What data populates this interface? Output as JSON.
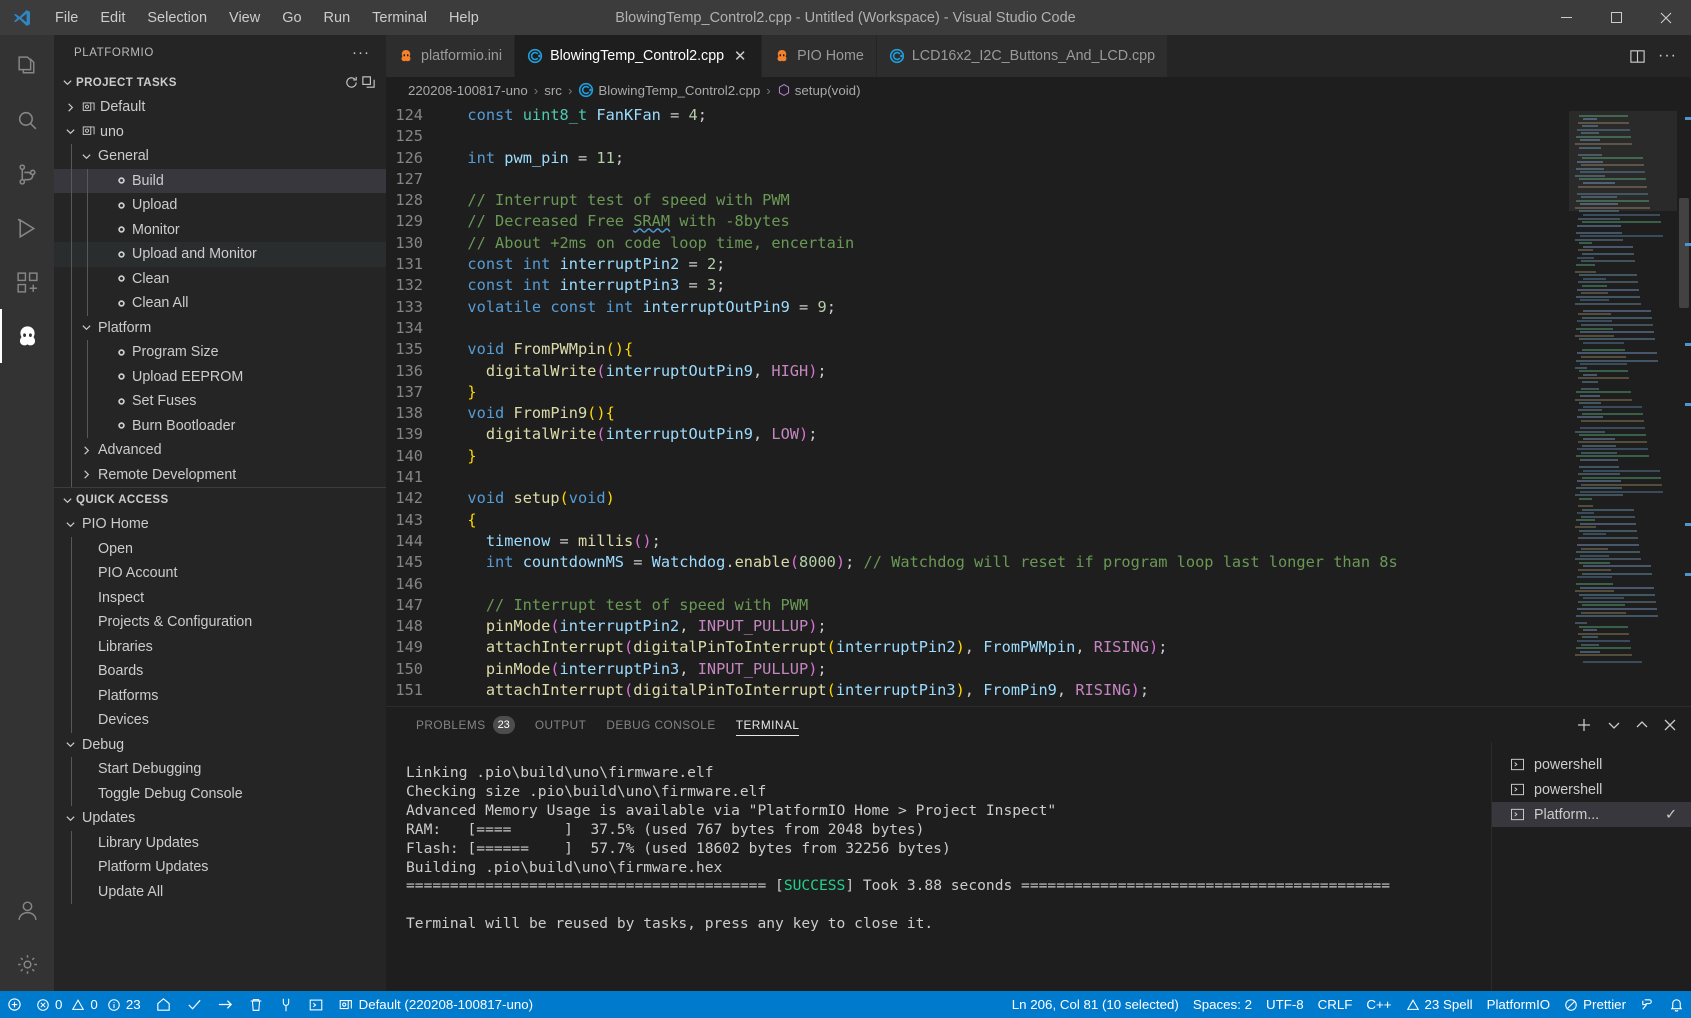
{
  "window": {
    "title": "BlowingTemp_Control2.cpp - Untitled (Workspace) - Visual Studio Code",
    "menus": [
      "File",
      "Edit",
      "Selection",
      "View",
      "Go",
      "Run",
      "Terminal",
      "Help"
    ],
    "controls": {
      "minimize": "minimize-icon",
      "maximize": "maximize-icon",
      "close": "close-icon"
    }
  },
  "activitybar": {
    "items": [
      {
        "name": "explorer",
        "icon": "files-icon"
      },
      {
        "name": "search",
        "icon": "search-icon"
      },
      {
        "name": "source-control",
        "icon": "source-control-icon"
      },
      {
        "name": "run-and-debug",
        "icon": "debug-alt-icon"
      },
      {
        "name": "extensions",
        "icon": "extensions-icon"
      },
      {
        "name": "platformio",
        "icon": "platformio-alien-icon"
      }
    ],
    "bottom": [
      {
        "name": "accounts",
        "icon": "account-icon"
      },
      {
        "name": "manage",
        "icon": "gear-icon"
      }
    ]
  },
  "sidebar": {
    "title": "PLATFORMIO",
    "more_actions": "···",
    "sections": [
      {
        "label": "PROJECT TASKS",
        "expanded": true,
        "actions": [
          "refresh-icon",
          "collapse-all-icon"
        ],
        "items": [
          {
            "label": "Default",
            "depth": 1,
            "twisty": "collapsed",
            "icon": "circuit-board-icon"
          },
          {
            "label": "uno",
            "depth": 1,
            "twisty": "expanded",
            "icon": "circuit-board-icon"
          },
          {
            "label": "General",
            "depth": 2,
            "twisty": "expanded",
            "icon": ""
          },
          {
            "label": "Build",
            "depth": 3,
            "twisty": "none",
            "icon": "task-dot-icon",
            "state": "selected"
          },
          {
            "label": "Upload",
            "depth": 3,
            "twisty": "none",
            "icon": "task-dot-icon"
          },
          {
            "label": "Monitor",
            "depth": 3,
            "twisty": "none",
            "icon": "task-dot-icon"
          },
          {
            "label": "Upload and Monitor",
            "depth": 3,
            "twisty": "none",
            "icon": "task-dot-icon",
            "state": "hovered"
          },
          {
            "label": "Clean",
            "depth": 3,
            "twisty": "none",
            "icon": "task-dot-icon"
          },
          {
            "label": "Clean All",
            "depth": 3,
            "twisty": "none",
            "icon": "task-dot-icon"
          },
          {
            "label": "Platform",
            "depth": 2,
            "twisty": "expanded",
            "icon": ""
          },
          {
            "label": "Program Size",
            "depth": 3,
            "twisty": "none",
            "icon": "task-dot-icon"
          },
          {
            "label": "Upload EEPROM",
            "depth": 3,
            "twisty": "none",
            "icon": "task-dot-icon"
          },
          {
            "label": "Set Fuses",
            "depth": 3,
            "twisty": "none",
            "icon": "task-dot-icon"
          },
          {
            "label": "Burn Bootloader",
            "depth": 3,
            "twisty": "none",
            "icon": "task-dot-icon"
          },
          {
            "label": "Advanced",
            "depth": 2,
            "twisty": "collapsed",
            "icon": ""
          },
          {
            "label": "Remote Development",
            "depth": 2,
            "twisty": "collapsed",
            "icon": ""
          }
        ]
      },
      {
        "label": "QUICK ACCESS",
        "expanded": true,
        "actions": [],
        "items": [
          {
            "label": "PIO Home",
            "depth": 1,
            "twisty": "expanded",
            "icon": ""
          },
          {
            "label": "Open",
            "depth": 2,
            "twisty": "none",
            "icon": ""
          },
          {
            "label": "PIO Account",
            "depth": 2,
            "twisty": "none",
            "icon": ""
          },
          {
            "label": "Inspect",
            "depth": 2,
            "twisty": "none",
            "icon": ""
          },
          {
            "label": "Projects & Configuration",
            "depth": 2,
            "twisty": "none",
            "icon": ""
          },
          {
            "label": "Libraries",
            "depth": 2,
            "twisty": "none",
            "icon": ""
          },
          {
            "label": "Boards",
            "depth": 2,
            "twisty": "none",
            "icon": ""
          },
          {
            "label": "Platforms",
            "depth": 2,
            "twisty": "none",
            "icon": ""
          },
          {
            "label": "Devices",
            "depth": 2,
            "twisty": "none",
            "icon": ""
          },
          {
            "label": "Debug",
            "depth": 1,
            "twisty": "expanded",
            "icon": ""
          },
          {
            "label": "Start Debugging",
            "depth": 2,
            "twisty": "none",
            "icon": ""
          },
          {
            "label": "Toggle Debug Console",
            "depth": 2,
            "twisty": "none",
            "icon": ""
          },
          {
            "label": "Updates",
            "depth": 1,
            "twisty": "expanded",
            "icon": ""
          },
          {
            "label": "Library Updates",
            "depth": 2,
            "twisty": "none",
            "icon": ""
          },
          {
            "label": "Platform Updates",
            "depth": 2,
            "twisty": "none",
            "icon": ""
          },
          {
            "label": "Update All",
            "depth": 2,
            "twisty": "none",
            "icon": ""
          }
        ]
      }
    ]
  },
  "editor": {
    "tabs": [
      {
        "label": "platformio.ini",
        "icon": "platformio-alien-icon",
        "active": false,
        "closable": false
      },
      {
        "label": "BlowingTemp_Control2.cpp",
        "icon": "cpp-icon",
        "active": true,
        "closable": true
      },
      {
        "label": "PIO Home",
        "icon": "platformio-alien-icon",
        "active": false,
        "closable": false
      },
      {
        "label": "LCD16x2_I2C_Buttons_And_LCD.cpp",
        "icon": "cpp-icon",
        "active": false,
        "closable": false
      }
    ],
    "tab_actions": [
      "split-editor-icon",
      "more-actions-icon"
    ],
    "breadcrumb": [
      {
        "label": "220208-100817-uno",
        "icon": ""
      },
      {
        "label": "src",
        "icon": ""
      },
      {
        "label": "BlowingTemp_Control2.cpp",
        "icon": "cpp-icon"
      },
      {
        "label": "setup(void)",
        "icon": "symbol-method-icon"
      }
    ],
    "first_line_number": 124,
    "lines": [
      {
        "n": 124,
        "html": "  <span class=\"kw\">const</span> <span class=\"typ\">uint8_t</span> <span class=\"var\">FanKFan</span> = <span class=\"num\">4</span>;"
      },
      {
        "n": 125,
        "html": ""
      },
      {
        "n": 126,
        "html": "  <span class=\"kw\">int</span> <span class=\"var\">pwm_pin</span> = <span class=\"num\">11</span>;"
      },
      {
        "n": 127,
        "html": ""
      },
      {
        "n": 128,
        "html": "  <span class=\"cmt\">// Interrupt test of speed with PWM</span>"
      },
      {
        "n": 129,
        "html": "  <span class=\"cmt\">// Decreased Free <span class=\"squig\">SRAM</span> with -8bytes</span>"
      },
      {
        "n": 130,
        "html": "  <span class=\"cmt\">// About +2ms on code loop time, encertain</span>"
      },
      {
        "n": 131,
        "html": "  <span class=\"kw\">const</span> <span class=\"kw\">int</span> <span class=\"var\">interruptPin2</span> = <span class=\"num\">2</span>;"
      },
      {
        "n": 132,
        "html": "  <span class=\"kw\">const</span> <span class=\"kw\">int</span> <span class=\"var\">interruptPin3</span> = <span class=\"num\">3</span>;"
      },
      {
        "n": 133,
        "html": "  <span class=\"kw\">volatile</span> <span class=\"kw\">const</span> <span class=\"kw\">int</span> <span class=\"var\">interruptOutPin9</span> = <span class=\"num\">9</span>;"
      },
      {
        "n": 134,
        "html": ""
      },
      {
        "n": 135,
        "html": "  <span class=\"kw\">void</span> <span class=\"fn\">FromPWMpin</span><span class=\"brc2\">()</span><span class=\"brc2\">{</span>"
      },
      {
        "n": 136,
        "html": "    <span class=\"fn\">digitalWrite</span><span class=\"brc\">(</span><span class=\"var\">interruptOutPin9</span>, <span class=\"mac\">HIGH</span><span class=\"brc\">)</span>;"
      },
      {
        "n": 137,
        "html": "  <span class=\"brc2\">}</span>"
      },
      {
        "n": 138,
        "html": "  <span class=\"kw\">void</span> <span class=\"fn\">FromPin9</span><span class=\"brc2\">()</span><span class=\"brc2\">{</span>"
      },
      {
        "n": 139,
        "html": "    <span class=\"fn\">digitalWrite</span><span class=\"brc\">(</span><span class=\"var\">interruptOutPin9</span>, <span class=\"mac\">LOW</span><span class=\"brc\">)</span>;"
      },
      {
        "n": 140,
        "html": "  <span class=\"brc2\">}</span>"
      },
      {
        "n": 141,
        "html": ""
      },
      {
        "n": 142,
        "html": "  <span class=\"kw\">void</span> <span class=\"fn\">setup</span><span class=\"brc2\">(</span><span class=\"kw\">void</span><span class=\"brc2\">)</span>"
      },
      {
        "n": 143,
        "html": "  <span class=\"brc2\">{</span>"
      },
      {
        "n": 144,
        "html": "    <span class=\"var\">timenow</span> = <span class=\"fn\">millis</span><span class=\"brc\">()</span>;"
      },
      {
        "n": 145,
        "html": "    <span class=\"kw\">int</span> <span class=\"var\">countdownMS</span> = <span class=\"var\">Watchdog</span>.<span class=\"fn\">enable</span><span class=\"brc\">(</span><span class=\"num\">8000</span><span class=\"brc\">)</span>; <span class=\"cmt\">// Watchdog will reset if program loop last longer than 8s</span>"
      },
      {
        "n": 146,
        "html": ""
      },
      {
        "n": 147,
        "html": "    <span class=\"cmt\">// Interrupt test of speed with PWM</span>"
      },
      {
        "n": 148,
        "html": "    <span class=\"fn\">pinMode</span><span class=\"brc\">(</span><span class=\"var\">interruptPin2</span>, <span class=\"mac\">INPUT_PULLUP</span><span class=\"brc\">)</span>;"
      },
      {
        "n": 149,
        "html": "    <span class=\"fn\">attachInterrupt</span><span class=\"brc\">(</span><span class=\"fn\">digitalPinToInterrupt</span><span class=\"brc2\">(</span><span class=\"var\">interruptPin2</span><span class=\"brc2\">)</span>, <span class=\"var\">FromPWMpin</span>, <span class=\"mac\">RISING</span><span class=\"brc\">)</span>;"
      },
      {
        "n": 150,
        "html": "    <span class=\"fn\">pinMode</span><span class=\"brc\">(</span><span class=\"var\">interruptPin3</span>, <span class=\"mac\">INPUT_PULLUP</span><span class=\"brc\">)</span>;"
      },
      {
        "n": 151,
        "html": "    <span class=\"fn\">attachInterrupt</span><span class=\"brc\">(</span><span class=\"fn\">digitalPinToInterrupt</span><span class=\"brc2\">(</span><span class=\"var\">interruptPin3</span><span class=\"brc2\">)</span>, <span class=\"var\">FromPin9</span>, <span class=\"mac\">RISING</span><span class=\"brc\">)</span>;"
      }
    ]
  },
  "panel": {
    "tabs": [
      {
        "label": "PROBLEMS",
        "badge": "23",
        "active": false
      },
      {
        "label": "OUTPUT",
        "badge": "",
        "active": false
      },
      {
        "label": "DEBUG CONSOLE",
        "badge": "",
        "active": false
      },
      {
        "label": "TERMINAL",
        "badge": "",
        "active": true
      }
    ],
    "actions": [
      "add-terminal-icon",
      "chevron-down-icon",
      "maximize-panel-icon",
      "close-panel-icon"
    ],
    "terminal_output": [
      {
        "text": "Linking .pio\\build\\uno\\firmware.elf"
      },
      {
        "text": "Checking size .pio\\build\\uno\\firmware.elf"
      },
      {
        "text": "Advanced Memory Usage is available via \"PlatformIO Home > Project Inspect\""
      },
      {
        "text": "RAM:   [====      ]  37.5% (used 767 bytes from 2048 bytes)"
      },
      {
        "text": "Flash: [======    ]  57.7% (used 18602 bytes from 32256 bytes)"
      },
      {
        "text": "Building .pio\\build\\uno\\firmware.hex"
      },
      {
        "pre": "========================================= [",
        "success": "SUCCESS",
        "post": "] Took 3.88 seconds =========================================="
      },
      {
        "text": ""
      },
      {
        "text": "Terminal will be reused by tasks, press any key to close it."
      }
    ],
    "terminal_list": [
      {
        "label": "powershell",
        "icon": "terminal-icon",
        "active": false,
        "check": ""
      },
      {
        "label": "powershell",
        "icon": "terminal-icon",
        "active": false,
        "check": ""
      },
      {
        "label": "Platform...",
        "icon": "terminal-icon",
        "active": true,
        "check": "✓"
      }
    ]
  },
  "statusbar": {
    "left": [
      {
        "name": "remote-indicator",
        "label": "",
        "icon": "remote-icon"
      },
      {
        "name": "problems",
        "label": "0  0  23",
        "errors": "0",
        "warnings": "0",
        "infos": "23"
      },
      {
        "name": "pio-home",
        "label": "",
        "icon": "home-icon"
      },
      {
        "name": "pio-build",
        "label": "",
        "icon": "check-icon"
      },
      {
        "name": "pio-upload",
        "label": "",
        "icon": "arrow-right-icon"
      },
      {
        "name": "pio-clean",
        "label": "",
        "icon": "trash-icon"
      },
      {
        "name": "pio-test",
        "label": "",
        "icon": "plug-icon"
      },
      {
        "name": "pio-serial-monitor",
        "label": "",
        "icon": "terminal-icon"
      },
      {
        "name": "pio-env",
        "label": "Default (220208-100817-uno)",
        "icon": "circuit-board-icon"
      }
    ],
    "right": [
      {
        "name": "editor-position",
        "label": "Ln 206, Col 81 (10 selected)"
      },
      {
        "name": "indentation",
        "label": "Spaces: 2"
      },
      {
        "name": "encoding",
        "label": "UTF-8"
      },
      {
        "name": "eol",
        "label": "CRLF"
      },
      {
        "name": "language-mode",
        "label": "C++"
      },
      {
        "name": "spell-checker",
        "label": "23 Spell",
        "icon": "warning-icon"
      },
      {
        "name": "platformio-status",
        "label": "PlatformIO"
      },
      {
        "name": "prettier",
        "label": "Prettier",
        "icon": "prettier-icon"
      },
      {
        "name": "remote-open",
        "label": "",
        "icon": "remote-open-icon"
      },
      {
        "name": "notifications",
        "label": "",
        "icon": "bell-icon"
      }
    ],
    "accent": "#007acc"
  },
  "colors": {
    "accent": "#007acc",
    "editor_bg": "#1e1e1e",
    "sidebar_bg": "#252526",
    "activitybar_bg": "#333333",
    "titlebar_bg": "#3c3c3c",
    "success": "#23d18b",
    "selection": "#37373d"
  }
}
